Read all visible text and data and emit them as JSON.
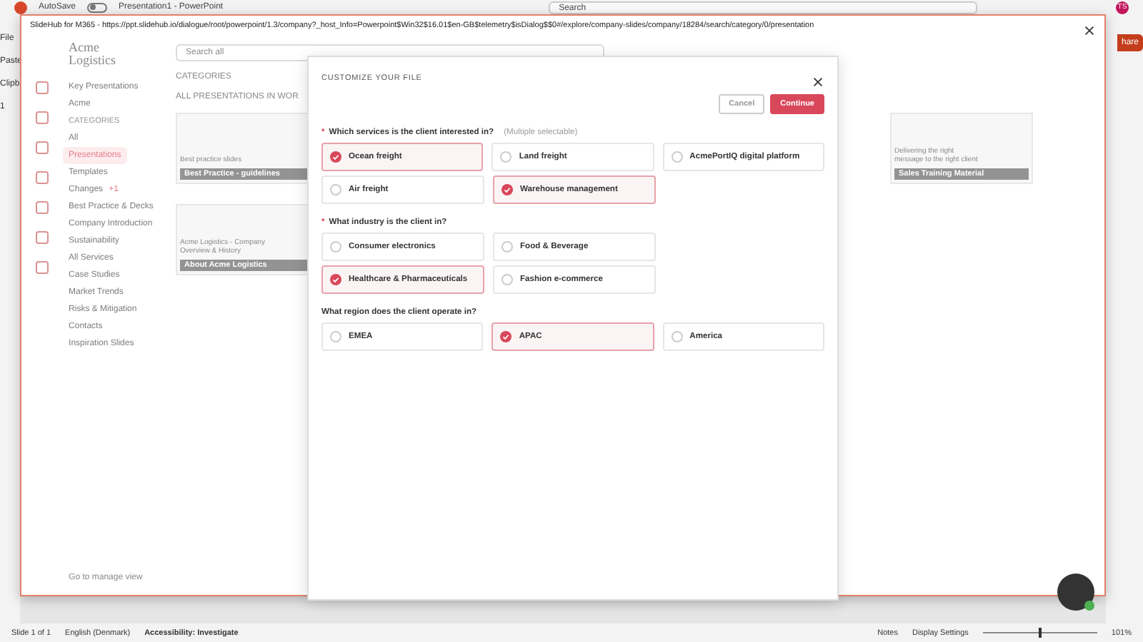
{
  "powerpoint": {
    "autosave": "AutoSave",
    "autosave_on": false,
    "title": "Presentation1 - PowerPoint",
    "search_placeholder": "Search",
    "user_initials": "TS",
    "menu": "File",
    "share": "hare",
    "paste": "Paste",
    "clipboard": "Clipb",
    "slide_number": "1"
  },
  "dialog": {
    "title": "SlideHub for M365 - https://ppt.slidehub.io/dialogue/root/powerpoint/1.3/company?_host_Info=Powerpoint$Win32$16.01$en-GB$telemetry$isDialog$$0#/explore/company-slides/company/18284/search/category/0/presentation"
  },
  "app": {
    "brand": {
      "line_1": "Acme",
      "line_2": "Logistics"
    },
    "search_placeholder": "Search all",
    "sidebar": {
      "items": [
        {
          "label": "Key Presentations",
          "selected": false
        },
        {
          "label": "Acme",
          "selected": false
        }
      ],
      "categories_heading": "CATEGORIES",
      "categories": [
        {
          "label": "All",
          "selected": false
        },
        {
          "label": "Presentations",
          "selected": true
        },
        {
          "label": "Templates",
          "selected": false
        },
        {
          "label": "Changes",
          "selected": false,
          "badge": "+1"
        },
        {
          "label": "Best Practice & Decks",
          "selected": false
        },
        {
          "label": "Company Introduction",
          "selected": false
        },
        {
          "label": "Sustainability",
          "selected": false
        },
        {
          "label": "All Services",
          "selected": false
        },
        {
          "label": "Case Studies",
          "selected": false
        },
        {
          "label": "Market Trends",
          "selected": false
        },
        {
          "label": "Risks & Mitigation",
          "selected": false
        },
        {
          "label": "Contacts",
          "selected": false
        },
        {
          "label": "Inspiration Slides",
          "selected": false
        }
      ],
      "footer_link": "Go to manage view"
    },
    "categories_label": "CATEGORIES",
    "section_heading": "ALL PRESENTATIONS IN WOR",
    "cards": [
      {
        "title": "Best Practice - guidelines",
        "caption": "Best practice slides"
      },
      {
        "title": "Sales Training Material",
        "caption": "Delivering the right message to the right client"
      },
      {
        "title": "About Acme Logistics",
        "caption": "Acme Logistics - Company Overview & History"
      }
    ]
  },
  "modal": {
    "title": "CUSTOMIZE YOUR FILE",
    "buttons": [
      {
        "label": "Cancel",
        "kind": "secondary"
      },
      {
        "label": "Continue",
        "kind": "primary"
      }
    ],
    "questions": [
      {
        "marker": "*",
        "label": "Which services is the client interested in?",
        "hint": "(Multiple selectable)",
        "rows": [
          [
            {
              "label": "Ocean freight",
              "selected": true
            },
            {
              "label": "Land freight",
              "selected": false
            },
            {
              "label": "AcmePortIQ digital platform",
              "selected": false
            }
          ],
          [
            {
              "label": "Air freight",
              "selected": false
            },
            {
              "label": "Warehouse management",
              "selected": true
            }
          ]
        ]
      },
      {
        "marker": "*",
        "label": "What industry is the client in?",
        "rows": [
          [
            {
              "label": "Consumer electronics",
              "selected": false
            },
            {
              "label": "Food & Beverage",
              "selected": false
            }
          ],
          [
            {
              "label": "Healthcare & Pharmaceuticals",
              "selected": true
            },
            {
              "label": "Fashion e-commerce",
              "selected": false
            }
          ]
        ]
      },
      {
        "label": "What region does the client operate in?",
        "rows": [
          [
            {
              "label": "EMEA",
              "selected": false
            },
            {
              "label": "APAC",
              "selected": true
            },
            {
              "label": "America",
              "selected": false
            }
          ]
        ]
      }
    ]
  },
  "status_bar": {
    "slide": "Slide 1 of 1",
    "language": "English (Denmark)",
    "accessibility": "Accessibility: Investigate",
    "notes": "Notes",
    "display": "Display Settings",
    "zoom_slider": {
      "level": 0.5
    },
    "zoom": "101%"
  }
}
